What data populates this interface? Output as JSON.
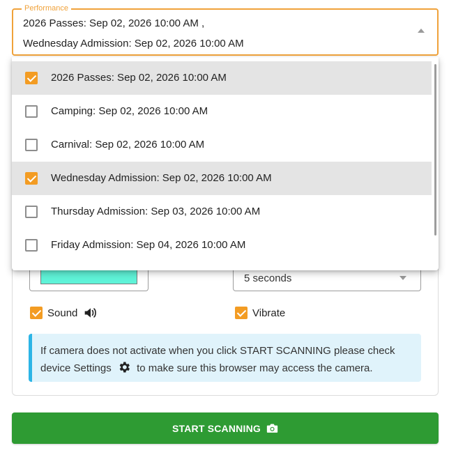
{
  "performance": {
    "legend": "Performance",
    "selected_line1": "2026 Passes: Sep 02, 2026 10:00 AM ,",
    "selected_line2": "Wednesday Admission: Sep 02, 2026 10:00 AM",
    "options": [
      {
        "label": "2026 Passes: Sep 02, 2026 10:00 AM",
        "checked": true
      },
      {
        "label": "Camping: Sep 02, 2026 10:00 AM",
        "checked": false
      },
      {
        "label": "Carnival: Sep 02, 2026 10:00 AM",
        "checked": false
      },
      {
        "label": "Wednesday Admission: Sep 02, 2026 10:00 AM",
        "checked": true
      },
      {
        "label": "Thursday Admission: Sep 03, 2026 10:00 AM",
        "checked": false
      },
      {
        "label": "Friday Admission: Sep 04, 2026 10:00 AM",
        "checked": false
      }
    ]
  },
  "settings": {
    "scan_color": "#5ff3d8",
    "delay_value": "5 seconds",
    "sound_label": "Sound",
    "sound_checked": true,
    "vibrate_label": "Vibrate",
    "vibrate_checked": true
  },
  "info": {
    "text_before": "If camera does not activate when you click START SCANNING please check device Settings",
    "text_after": "to make sure this browser may access the camera."
  },
  "scan_button": {
    "label": "START SCANNING"
  },
  "colors": {
    "accent_orange": "#f39c23",
    "selected_row": "#e4e4e4",
    "info_bg": "#e0f3fb",
    "info_border": "#2cb5e6",
    "button_green": "#2e9b33"
  }
}
